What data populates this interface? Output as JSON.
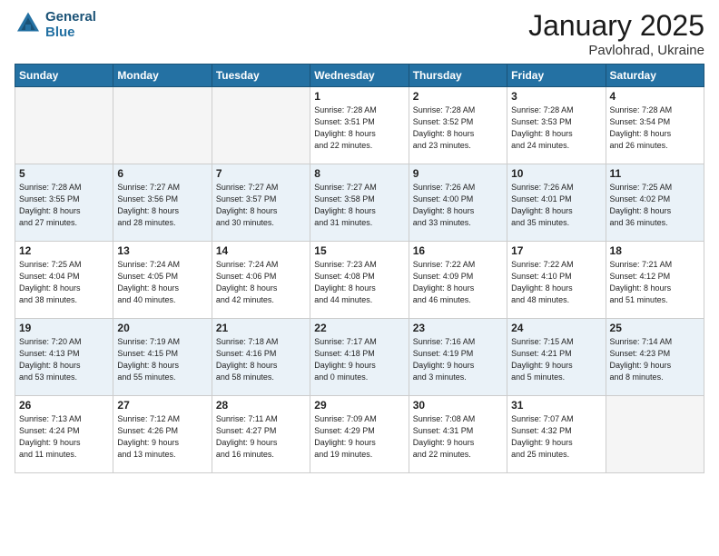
{
  "logo": {
    "line1": "General",
    "line2": "Blue"
  },
  "title": "January 2025",
  "location": "Pavlohrad, Ukraine",
  "days_of_week": [
    "Sunday",
    "Monday",
    "Tuesday",
    "Wednesday",
    "Thursday",
    "Friday",
    "Saturday"
  ],
  "weeks": [
    [
      {
        "day": "",
        "info": ""
      },
      {
        "day": "",
        "info": ""
      },
      {
        "day": "",
        "info": ""
      },
      {
        "day": "1",
        "info": "Sunrise: 7:28 AM\nSunset: 3:51 PM\nDaylight: 8 hours\nand 22 minutes."
      },
      {
        "day": "2",
        "info": "Sunrise: 7:28 AM\nSunset: 3:52 PM\nDaylight: 8 hours\nand 23 minutes."
      },
      {
        "day": "3",
        "info": "Sunrise: 7:28 AM\nSunset: 3:53 PM\nDaylight: 8 hours\nand 24 minutes."
      },
      {
        "day": "4",
        "info": "Sunrise: 7:28 AM\nSunset: 3:54 PM\nDaylight: 8 hours\nand 26 minutes."
      }
    ],
    [
      {
        "day": "5",
        "info": "Sunrise: 7:28 AM\nSunset: 3:55 PM\nDaylight: 8 hours\nand 27 minutes."
      },
      {
        "day": "6",
        "info": "Sunrise: 7:27 AM\nSunset: 3:56 PM\nDaylight: 8 hours\nand 28 minutes."
      },
      {
        "day": "7",
        "info": "Sunrise: 7:27 AM\nSunset: 3:57 PM\nDaylight: 8 hours\nand 30 minutes."
      },
      {
        "day": "8",
        "info": "Sunrise: 7:27 AM\nSunset: 3:58 PM\nDaylight: 8 hours\nand 31 minutes."
      },
      {
        "day": "9",
        "info": "Sunrise: 7:26 AM\nSunset: 4:00 PM\nDaylight: 8 hours\nand 33 minutes."
      },
      {
        "day": "10",
        "info": "Sunrise: 7:26 AM\nSunset: 4:01 PM\nDaylight: 8 hours\nand 35 minutes."
      },
      {
        "day": "11",
        "info": "Sunrise: 7:25 AM\nSunset: 4:02 PM\nDaylight: 8 hours\nand 36 minutes."
      }
    ],
    [
      {
        "day": "12",
        "info": "Sunrise: 7:25 AM\nSunset: 4:04 PM\nDaylight: 8 hours\nand 38 minutes."
      },
      {
        "day": "13",
        "info": "Sunrise: 7:24 AM\nSunset: 4:05 PM\nDaylight: 8 hours\nand 40 minutes."
      },
      {
        "day": "14",
        "info": "Sunrise: 7:24 AM\nSunset: 4:06 PM\nDaylight: 8 hours\nand 42 minutes."
      },
      {
        "day": "15",
        "info": "Sunrise: 7:23 AM\nSunset: 4:08 PM\nDaylight: 8 hours\nand 44 minutes."
      },
      {
        "day": "16",
        "info": "Sunrise: 7:22 AM\nSunset: 4:09 PM\nDaylight: 8 hours\nand 46 minutes."
      },
      {
        "day": "17",
        "info": "Sunrise: 7:22 AM\nSunset: 4:10 PM\nDaylight: 8 hours\nand 48 minutes."
      },
      {
        "day": "18",
        "info": "Sunrise: 7:21 AM\nSunset: 4:12 PM\nDaylight: 8 hours\nand 51 minutes."
      }
    ],
    [
      {
        "day": "19",
        "info": "Sunrise: 7:20 AM\nSunset: 4:13 PM\nDaylight: 8 hours\nand 53 minutes."
      },
      {
        "day": "20",
        "info": "Sunrise: 7:19 AM\nSunset: 4:15 PM\nDaylight: 8 hours\nand 55 minutes."
      },
      {
        "day": "21",
        "info": "Sunrise: 7:18 AM\nSunset: 4:16 PM\nDaylight: 8 hours\nand 58 minutes."
      },
      {
        "day": "22",
        "info": "Sunrise: 7:17 AM\nSunset: 4:18 PM\nDaylight: 9 hours\nand 0 minutes."
      },
      {
        "day": "23",
        "info": "Sunrise: 7:16 AM\nSunset: 4:19 PM\nDaylight: 9 hours\nand 3 minutes."
      },
      {
        "day": "24",
        "info": "Sunrise: 7:15 AM\nSunset: 4:21 PM\nDaylight: 9 hours\nand 5 minutes."
      },
      {
        "day": "25",
        "info": "Sunrise: 7:14 AM\nSunset: 4:23 PM\nDaylight: 9 hours\nand 8 minutes."
      }
    ],
    [
      {
        "day": "26",
        "info": "Sunrise: 7:13 AM\nSunset: 4:24 PM\nDaylight: 9 hours\nand 11 minutes."
      },
      {
        "day": "27",
        "info": "Sunrise: 7:12 AM\nSunset: 4:26 PM\nDaylight: 9 hours\nand 13 minutes."
      },
      {
        "day": "28",
        "info": "Sunrise: 7:11 AM\nSunset: 4:27 PM\nDaylight: 9 hours\nand 16 minutes."
      },
      {
        "day": "29",
        "info": "Sunrise: 7:09 AM\nSunset: 4:29 PM\nDaylight: 9 hours\nand 19 minutes."
      },
      {
        "day": "30",
        "info": "Sunrise: 7:08 AM\nSunset: 4:31 PM\nDaylight: 9 hours\nand 22 minutes."
      },
      {
        "day": "31",
        "info": "Sunrise: 7:07 AM\nSunset: 4:32 PM\nDaylight: 9 hours\nand 25 minutes."
      },
      {
        "day": "",
        "info": ""
      }
    ]
  ]
}
